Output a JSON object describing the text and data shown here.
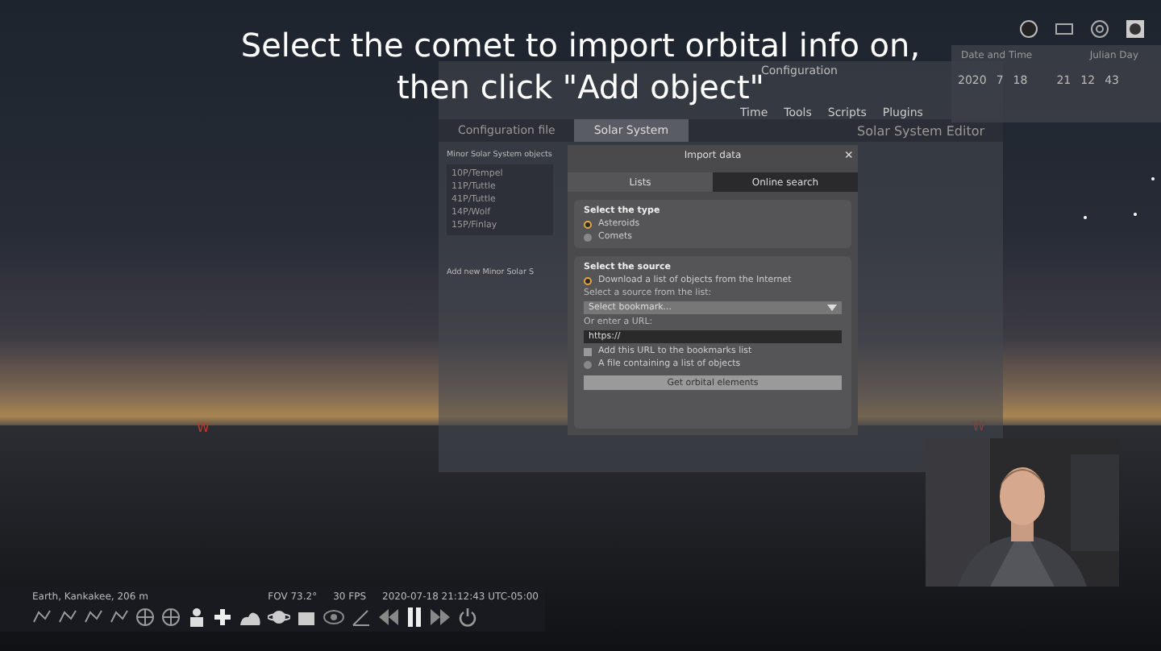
{
  "caption": [
    "Select the comet to import orbital info on,",
    "then click \"Add object\""
  ],
  "config_window": {
    "title": "Configuration",
    "toolbar": [
      "Time",
      "Tools",
      "Scripts",
      "Plugins"
    ],
    "tabs": [
      {
        "label": "Configuration file",
        "selected": false
      },
      {
        "label": "Solar System",
        "selected": true
      }
    ],
    "editor_title": "Solar System Editor",
    "heading": "Minor Solar System objects",
    "objects": [
      "10P/Tempel",
      "11P/Tuttle",
      "41P/Tuttle",
      "14P/Wolf",
      "15P/Finlay"
    ],
    "add_heading": "Add new Minor Solar S"
  },
  "date_window": {
    "title": "Date and Time",
    "julian_title": "Julian Day",
    "date": [
      "2020",
      "7",
      "18"
    ],
    "time": [
      "21",
      "12",
      "43"
    ]
  },
  "import_dialog": {
    "title": "Import data",
    "close": "×",
    "tabs": [
      {
        "label": "Lists",
        "selected": true
      },
      {
        "label": "Online search",
        "selected": false
      }
    ],
    "type_heading": "Select the type",
    "types": [
      {
        "label": "Asteroids",
        "selected": true
      },
      {
        "label": "Comets",
        "selected": false
      }
    ],
    "source_heading": "Select the source",
    "download_option": {
      "label": "Download a list of objects from the Internet",
      "selected": true
    },
    "source_label": "Select a source from the list:",
    "bookmark_select": "Select bookmark...",
    "url_label": "Or enter a URL:",
    "url_value": "https://",
    "bookmark_check": {
      "label": "Add this URL to the bookmarks list",
      "checked": false
    },
    "file_option": {
      "label": "A file containing a list of objects",
      "selected": false
    },
    "button": "Get orbital elements"
  },
  "compass": [
    "W",
    "W"
  ],
  "status_bar": {
    "location": "Earth, Kankakee, 206 m",
    "fov": "FOV 73.2°",
    "fps": "30 FPS",
    "datetime": "2020-07-18 21:12:43 UTC-05:00"
  },
  "webcam": {
    "kind": "picture"
  }
}
